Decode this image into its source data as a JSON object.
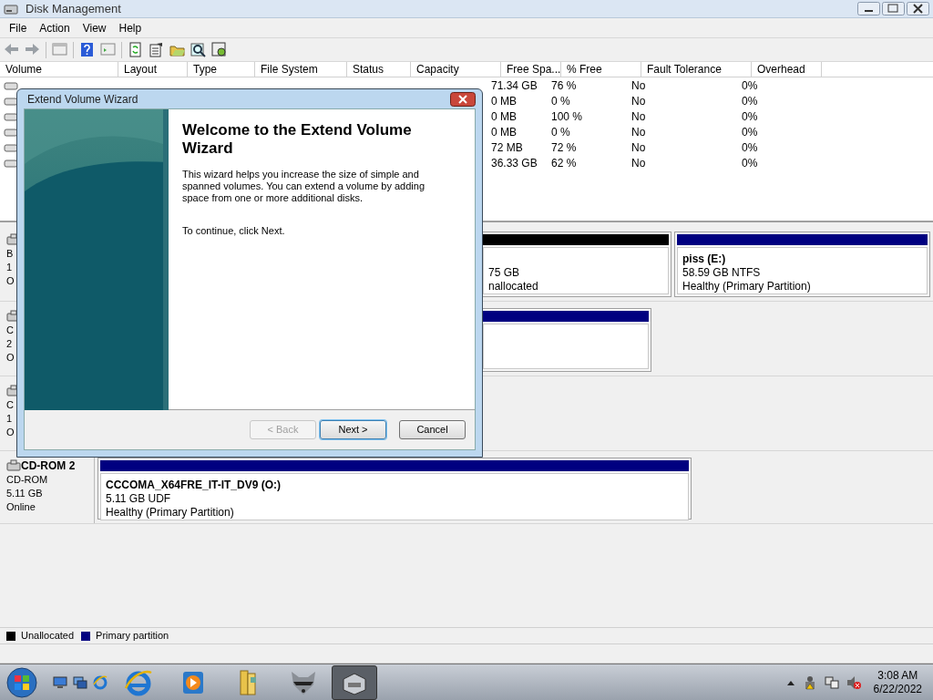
{
  "window": {
    "title": "Disk Management"
  },
  "menu": [
    "File",
    "Action",
    "View",
    "Help"
  ],
  "volume_table": {
    "columns": [
      "Volume",
      "Layout",
      "Type",
      "File System",
      "Status",
      "Capacity",
      "Free Spa...",
      "% Free",
      "Fault Tolerance",
      "Overhead"
    ],
    "rows": [
      {
        "free_space": "71.34 GB",
        "percent_free": "76 %",
        "fault_tolerance": "No",
        "overhead": "0%"
      },
      {
        "free_space": "0 MB",
        "percent_free": "0 %",
        "fault_tolerance": "No",
        "overhead": "0%"
      },
      {
        "free_space": "0 MB",
        "percent_free": "100 %",
        "fault_tolerance": "No",
        "overhead": "0%"
      },
      {
        "free_space": "0 MB",
        "percent_free": "0 %",
        "fault_tolerance": "No",
        "overhead": "0%"
      },
      {
        "free_space": "72 MB",
        "percent_free": "72 %",
        "fault_tolerance": "No",
        "overhead": "0%"
      },
      {
        "free_space": "36.33 GB",
        "percent_free": "62 %",
        "fault_tolerance": "No",
        "overhead": "0%"
      }
    ]
  },
  "disks": [
    {
      "lines": [
        "B",
        "1",
        "O"
      ],
      "partitions": [
        {
          "kind": "unallocated",
          "lines": [
            "75 GB",
            "nallocated"
          ]
        },
        {
          "kind": "primary",
          "name": "piss  (E:)",
          "lines": [
            "58.59 GB NTFS",
            "Healthy (Primary Partition)"
          ]
        }
      ]
    },
    {
      "lines": [
        "C",
        "2",
        "O"
      ],
      "partitions": [
        {
          "kind": "primary"
        }
      ]
    },
    {
      "lines": [
        "C",
        "1",
        "O"
      ]
    },
    {
      "name": "CD-ROM 2",
      "lines": [
        "CD-ROM",
        "5.11 GB",
        "Online"
      ],
      "partitions": [
        {
          "kind": "primary",
          "name": "CCCOMA_X64FRE_IT-IT_DV9  (O:)",
          "lines": [
            "5.11 GB UDF",
            "Healthy (Primary Partition)"
          ]
        }
      ]
    }
  ],
  "legend": [
    {
      "label": "Unallocated",
      "color": "#000000"
    },
    {
      "label": "Primary partition",
      "color": "#000080"
    }
  ],
  "dialog": {
    "title": "Extend Volume Wizard",
    "heading": "Welcome to the Extend Volume Wizard",
    "body": "This wizard helps you increase the size of simple and spanned volumes. You can extend a volume  by adding space from one or more additional disks.",
    "continue": "To continue, click Next.",
    "buttons": [
      {
        "label": "< Back",
        "disabled": true,
        "focused": false
      },
      {
        "label": "Next >",
        "disabled": false,
        "focused": true
      },
      {
        "label": "Cancel",
        "disabled": false,
        "focused": false
      }
    ]
  },
  "taskbar": {
    "time": "3:08 AM",
    "date": "6/22/2022"
  }
}
